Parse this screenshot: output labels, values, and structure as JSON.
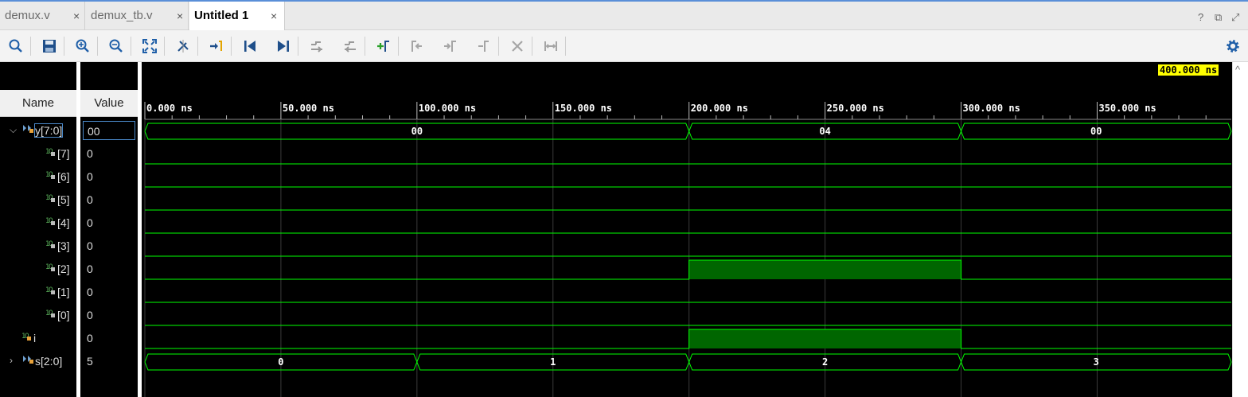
{
  "tabs": [
    {
      "label": "demux.v",
      "active": false
    },
    {
      "label": "demux_tb.v",
      "active": false
    },
    {
      "label": "Untitled 1",
      "active": true
    }
  ],
  "tab_close_glyph": "×",
  "window_controls": [
    "?",
    "⧉",
    "⤢"
  ],
  "toolbar": [
    {
      "icon": "search-icon",
      "label": "Search"
    },
    {
      "icon": "save-icon",
      "label": "Save Waveform Configuration"
    },
    {
      "icon": "zoom-in-icon",
      "label": "Zoom In"
    },
    {
      "icon": "zoom-out-icon",
      "label": "Zoom Out"
    },
    {
      "icon": "zoom-fit-icon",
      "label": "Zoom Fit"
    },
    {
      "icon": "zoom-to-cursor-icon",
      "label": "Zoom to Cursor"
    },
    {
      "icon": "go-to-time-zero-icon",
      "label": "Go to Time 0"
    },
    {
      "icon": "go-to-last-time-icon",
      "label": "Go to Last Time"
    },
    {
      "icon": "previous-transition-icon",
      "label": "Previous Transition"
    },
    {
      "icon": "next-transition-icon",
      "label": "Next Transition"
    },
    {
      "icon": "add-marker-icon",
      "label": "Add Marker"
    },
    {
      "icon": "previous-marker-icon",
      "label": "Previous Marker"
    },
    {
      "icon": "next-marker-icon",
      "label": "Next Marker"
    },
    {
      "icon": "swap-cursors-icon",
      "label": "Swap Cursors"
    },
    {
      "icon": "delete-icon",
      "label": "Delete"
    },
    {
      "icon": "snap-to-transition-icon",
      "label": "Snap to Transition"
    }
  ],
  "settings_icon": "gear-icon",
  "columns": {
    "name": "Name",
    "value": "Value"
  },
  "cursor_time": "400.000 ns",
  "time_ruler": {
    "unit": "ns",
    "labels": [
      "0.000 ns",
      "50.000 ns",
      "100.000 ns",
      "150.000 ns",
      "200.000 ns",
      "250.000 ns",
      "300.000 ns",
      "350.000 ns"
    ],
    "major_ticks_ns": [
      0,
      50,
      100,
      150,
      200,
      250,
      300,
      350
    ],
    "visible_range_ns": [
      0,
      400
    ]
  },
  "signals": [
    {
      "name": "y[7:0]",
      "value": "00",
      "kind": "bus",
      "expanded": true,
      "indent": 0,
      "selected": true,
      "segments": [
        {
          "start": 0,
          "end": 200,
          "label": "00"
        },
        {
          "start": 200,
          "end": 300,
          "label": "04"
        },
        {
          "start": 300,
          "end": 400,
          "label": "00"
        }
      ]
    },
    {
      "name": "[7]",
      "value": "0",
      "kind": "bit",
      "indent": 1,
      "high": []
    },
    {
      "name": "[6]",
      "value": "0",
      "kind": "bit",
      "indent": 1,
      "high": []
    },
    {
      "name": "[5]",
      "value": "0",
      "kind": "bit",
      "indent": 1,
      "high": []
    },
    {
      "name": "[4]",
      "value": "0",
      "kind": "bit",
      "indent": 1,
      "high": []
    },
    {
      "name": "[3]",
      "value": "0",
      "kind": "bit",
      "indent": 1,
      "high": []
    },
    {
      "name": "[2]",
      "value": "0",
      "kind": "bit",
      "indent": 1,
      "high": [
        [
          200,
          300
        ]
      ]
    },
    {
      "name": "[1]",
      "value": "0",
      "kind": "bit",
      "indent": 1,
      "high": []
    },
    {
      "name": "[0]",
      "value": "0",
      "kind": "bit",
      "indent": 1,
      "high": []
    },
    {
      "name": "i",
      "value": "0",
      "kind": "bit",
      "indent": 0,
      "high": [
        [
          200,
          300
        ]
      ]
    },
    {
      "name": "s[2:0]",
      "value": "5",
      "kind": "bus",
      "expanded": false,
      "indent": 0,
      "segments": [
        {
          "start": 0,
          "end": 100,
          "label": "0"
        },
        {
          "start": 100,
          "end": 200,
          "label": "1"
        },
        {
          "start": 200,
          "end": 300,
          "label": "2"
        },
        {
          "start": 300,
          "end": 400,
          "label": "3"
        }
      ]
    }
  ],
  "colors": {
    "wave": "#00ff00",
    "wave_fill": "#006600",
    "grid": "#3a3a3a",
    "cursor_bg": "#ffff00",
    "ruler_text": "#ffffff"
  }
}
